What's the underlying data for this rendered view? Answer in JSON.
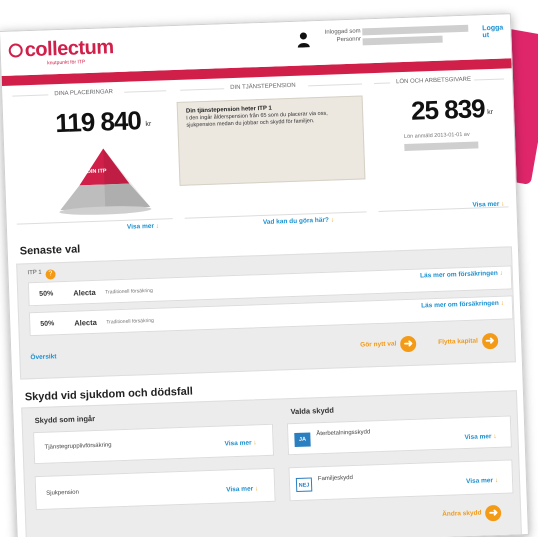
{
  "header": {
    "logo_text": "collectum",
    "tagline": "knutpunkt för ITP",
    "login_label": "Inloggad som",
    "personnr_label": "Personnr",
    "logout": "Logga ut"
  },
  "summary": {
    "placements": {
      "title": "DINA PLACERINGAR",
      "value": "119 840",
      "unit": "kr",
      "pyramid_label": "DIN ITP",
      "link": "Visa mer"
    },
    "pension": {
      "title": "DIN TJÄNSTEPENSION",
      "note_heading": "Din tjänstepension heter ITP 1",
      "note_body": "I den ingår ålderspension från 65 som du placerar via oss, sjukpension medan du jobbar och skydd för familjen.",
      "link": "Vad kan du göra här?"
    },
    "salary": {
      "title": "LÖN OCH ARBETSGIVARE",
      "value": "25 839",
      "unit": "kr",
      "reported": "Lön anmäld 2013-01-01 av",
      "link": "Visa mer"
    }
  },
  "latest": {
    "title": "Senaste val",
    "plan": "ITP 1",
    "rows": [
      {
        "pct": "50%",
        "company": "Alecta",
        "kind": "Traditionell försäkring",
        "link": "Läs mer om försäkringen"
      },
      {
        "pct": "50%",
        "company": "Alecta",
        "kind": "Traditionell försäkring",
        "link": "Läs mer om försäkringen"
      }
    ],
    "overview": "Översikt",
    "new_choice": "Gör nytt val",
    "move_capital": "Flytta kapital"
  },
  "protection": {
    "title": "Skydd vid sjukdom och dödsfall",
    "included_title": "Skydd som ingår",
    "selected_title": "Valda skydd",
    "included": [
      {
        "label": "Tjänstegrupplivförsäkring",
        "link": "Visa mer"
      },
      {
        "label": "Sjukpension",
        "link": "Visa mer"
      }
    ],
    "selected": [
      {
        "badge": "JA",
        "label": "Återbetalningsskydd",
        "link": "Visa mer"
      },
      {
        "badge": "NEJ",
        "label": "Familjeskydd",
        "link": "Visa mer"
      }
    ],
    "change": "Ändra skydd"
  },
  "colors": {
    "brand": "#d0204a",
    "link": "#1a8fd0",
    "accent": "#f39a17",
    "yes_badge": "#2a7fc1"
  }
}
